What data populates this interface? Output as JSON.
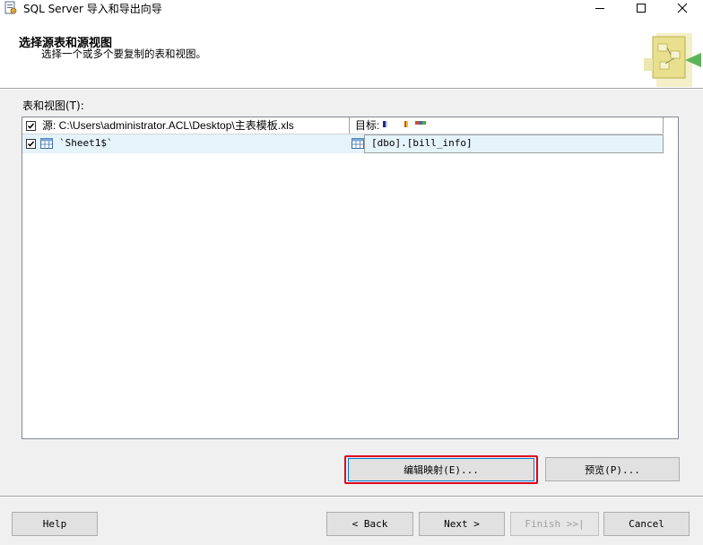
{
  "window": {
    "title": "SQL Server 导入和导出向导"
  },
  "header": {
    "title": "选择源表和源视图",
    "subtitle": "选择一个或多个要复制的表和视图。"
  },
  "tables": {
    "label": "表和视图(T):",
    "columns": {
      "source": "源: C:\\Users\\administrator.ACL\\Desktop\\主表模板.xls",
      "destination": "目标:"
    },
    "rows": [
      {
        "checked": true,
        "source": "`Sheet1$`",
        "destination": "[dbo].[bill_info]"
      }
    ]
  },
  "buttons": {
    "edit_mappings": "编辑映射(E)...",
    "preview": "预览(P)...",
    "help": "Help",
    "back": "< Back",
    "next": "Next >",
    "finish": "Finish >>|",
    "cancel": "Cancel"
  },
  "colors": {
    "highlight": "#e0001b",
    "row_selected": "#e5f3fb"
  }
}
